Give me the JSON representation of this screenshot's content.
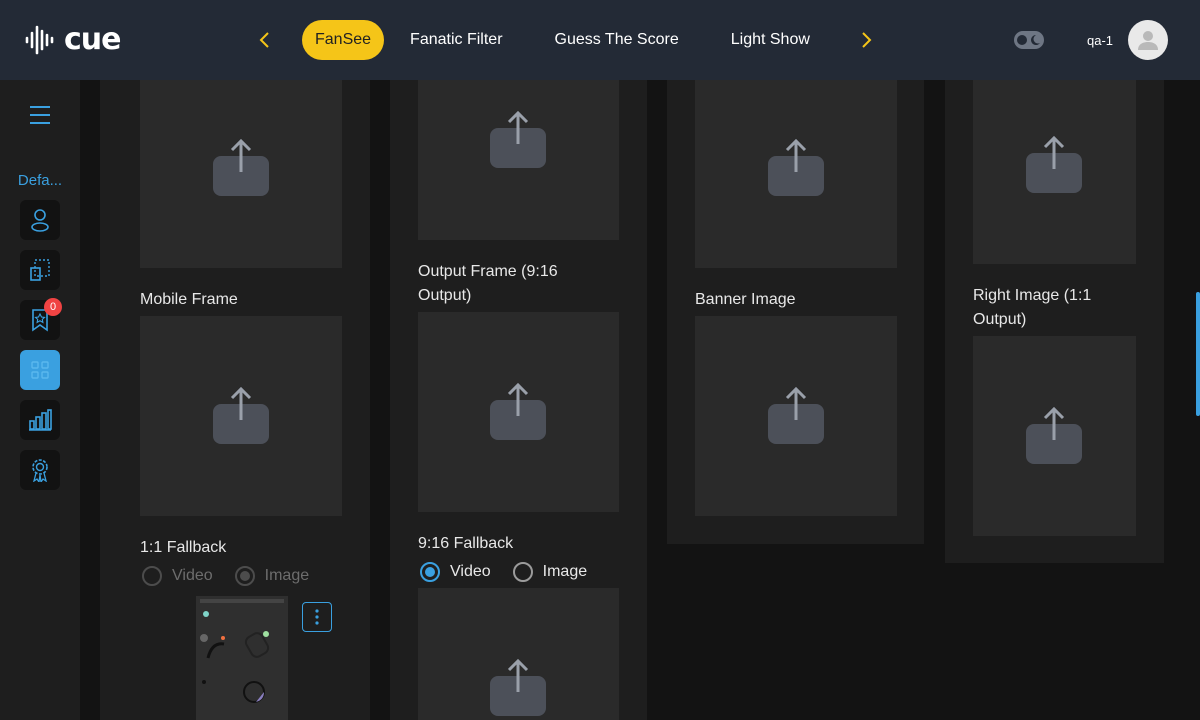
{
  "header": {
    "logo_text": "cue",
    "tabs": [
      {
        "label": "FanSee",
        "active": true
      },
      {
        "label": "Fanatic Filter",
        "active": false
      },
      {
        "label": "Guess The Score",
        "active": false
      },
      {
        "label": "Light Show",
        "active": false
      }
    ],
    "user_label": "qa-1"
  },
  "sidebar": {
    "label": "Defa...",
    "badge_count": "0"
  },
  "fields": {
    "mobile_frame": "Mobile Frame",
    "output_frame": "Output Frame (9:16 Output)",
    "banner_image": "Banner Image",
    "right_image": "Right Image (1:1 Output)",
    "fallback_1_1": "1:1 Fallback",
    "fallback_9_16": "9:16 Fallback"
  },
  "radios": {
    "video": "Video",
    "image": "Image"
  },
  "colors": {
    "accent": "#3aa0e0",
    "active_tab": "#f5c518",
    "header_bg": "#232a36",
    "badge": "#f04343"
  }
}
